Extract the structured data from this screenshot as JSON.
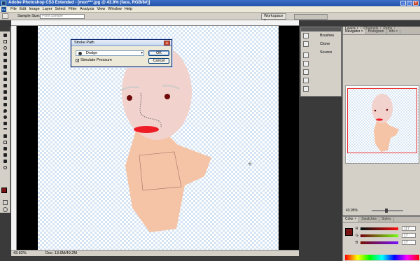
{
  "window": {
    "title": "Adobe Photoshop CS3 Extended - [mon***.jpg @ 43.9% (face, RGB/8#)]",
    "buttons": [
      "_",
      "□",
      "x"
    ]
  },
  "menubar": {
    "logo": "Ps",
    "items": [
      "File",
      "Edit",
      "Image",
      "Layer",
      "Select",
      "Filter",
      "Analysis",
      "View",
      "Window",
      "Help"
    ]
  },
  "options": {
    "sample_size_label": "Sample Size:",
    "sample_size_value": "Point Sample",
    "workspace_label": "Workspace ▾"
  },
  "toolbox": {
    "logo": "Ps",
    "foreground_color": "#7a1414",
    "background_color": "#ffffff"
  },
  "dialog": {
    "title": "Stroke Path",
    "tool_value": "Dodge",
    "dropdown_arrow": "▾",
    "simulate_pressure_label": "Simulate Pressure",
    "simulate_pressure_checked": "✓",
    "ok_label": "OK",
    "cancel_label": "Cancel",
    "close_glyph": "x"
  },
  "icon_dock": {
    "items": [
      {
        "label": "Brushes",
        "icon": "brush-icon"
      },
      {
        "label": "Clone Source",
        "icon": "clone-source-icon"
      }
    ]
  },
  "navigator_panel": {
    "tabs": [
      "Navigator ×",
      "Histogram",
      "Info ×"
    ],
    "zoom": "43.95%"
  },
  "layers_panel": {
    "tabs": [
      "Layers ×",
      "Channels",
      "Paths"
    ]
  },
  "color_panel": {
    "tabs": [
      "Color ×",
      "Swatches",
      "Styles"
    ],
    "r": {
      "label": "R",
      "value": "117"
    },
    "g": {
      "label": "G",
      "value": "17"
    },
    "b": {
      "label": "B",
      "value": "17"
    },
    "swatch_color": "#7a1414"
  },
  "status": {
    "zoom": "43.92%",
    "doc": "Doc: 13.6M/49.2M"
  },
  "colors": {
    "skin": "#f5c3a6",
    "face": "#f2d2cc",
    "lips": "#ee1c24",
    "eyes": "#6e0a0a"
  }
}
